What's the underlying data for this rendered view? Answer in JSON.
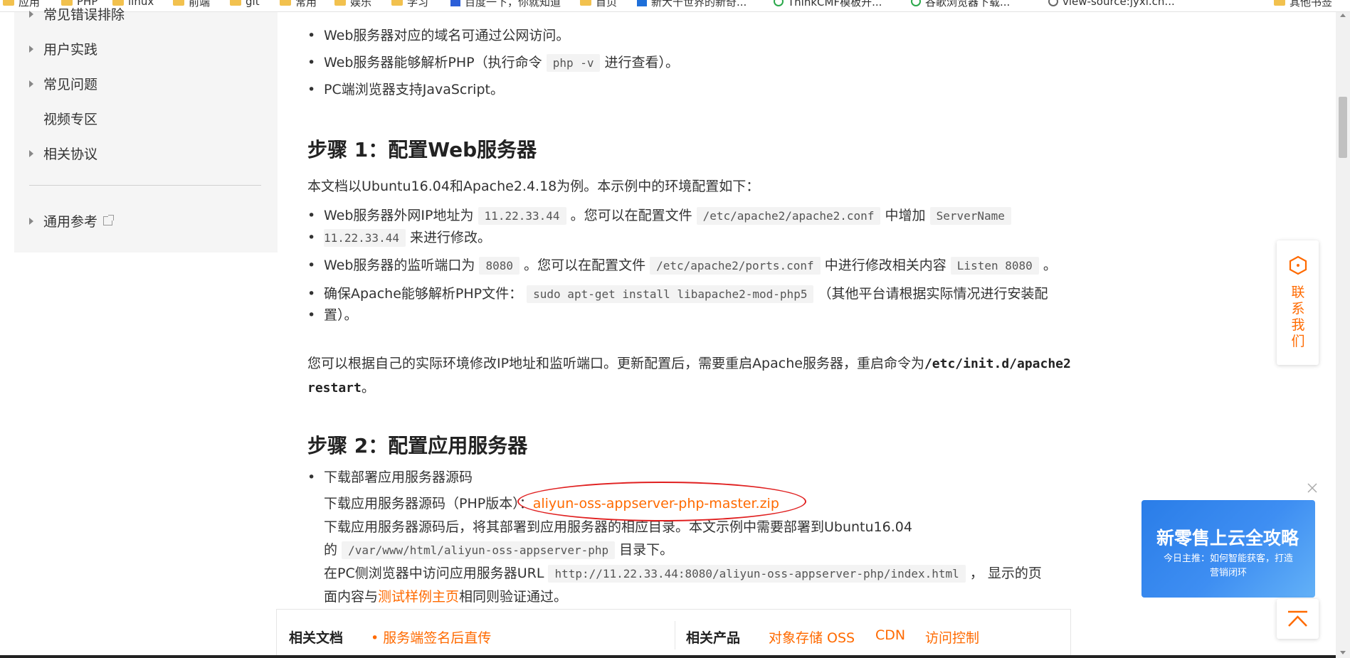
{
  "bookmarks": [
    {
      "label": "应用",
      "icon": "apps-icon"
    },
    {
      "label": "PHP",
      "icon": "folder-icon"
    },
    {
      "label": "linux",
      "icon": "folder-icon"
    },
    {
      "label": "前端",
      "icon": "folder-icon"
    },
    {
      "label": "git",
      "icon": "folder-icon"
    },
    {
      "label": "常用",
      "icon": "folder-icon"
    },
    {
      "label": "娱乐",
      "icon": "folder-icon"
    },
    {
      "label": "学习",
      "icon": "folder-icon"
    },
    {
      "label": "百度一下，你就知道",
      "icon": "paw-icon"
    },
    {
      "label": "首页",
      "icon": "folder-icon"
    },
    {
      "label": "新大千世界的新奇...",
      "icon": "news-icon"
    },
    {
      "label": "ThinkCMF模板开...",
      "icon": "leaf-icon"
    },
    {
      "label": "谷歌浏览器下载...",
      "icon": "leaf-icon"
    },
    {
      "label": "view-source:jyxl.cn...",
      "icon": "globe-icon"
    },
    {
      "label": "其他书签",
      "icon": "folder-icon"
    }
  ],
  "sidebar": {
    "items": [
      {
        "label": "常见错误排除",
        "expandable": true
      },
      {
        "label": "用户实践",
        "expandable": true
      },
      {
        "label": "常见问题",
        "expandable": true
      },
      {
        "label": "视频专区",
        "expandable": false
      },
      {
        "label": "相关协议",
        "expandable": true
      }
    ],
    "reference": {
      "label": "通用参考"
    }
  },
  "prereq": {
    "b1": "Web服务器对应的域名可通过公网访问。",
    "b2_pre": "Web服务器能够解析PHP（执行命令",
    "b2_code": "php -v",
    "b2_post": "进行查看）。",
    "b3": "PC端浏览器支持JavaScript。"
  },
  "step1": {
    "title": "步骤 1：配置Web服务器",
    "intro": "本文档以Ubuntu16.04和Apache2.4.18为例。本示例中的环境配置如下：",
    "b1_pre": "Web服务器外网IP地址为",
    "b1_code1": "11.22.33.44",
    "b1_mid": "。您可以在配置文件",
    "b1_code2": "/etc/apache2/apache2.conf",
    "b1_mid2": "中增加",
    "b1_code3": "ServerName",
    "b1_code4": "11.22.33.44",
    "b1_post": "来进行修改。",
    "b2_pre": "Web服务器的监听端口为",
    "b2_code1": "8080",
    "b2_mid": "。您可以在配置文件",
    "b2_code2": "/etc/apache2/ports.conf",
    "b2_mid2": "中进行修改相关内容",
    "b2_code3": "Listen 8080",
    "b2_post": "。",
    "b3_pre": "确保Apache能够解析PHP文件：",
    "b3_code": "sudo apt-get install libapache2-mod-php5",
    "b3_post": "（其他平台请根据实际情况进行安装配",
    "b3_line2": "置）。",
    "note_l1": "您可以根据自己的实际环境修改IP地址和监听端口。更新配置后，需要重启Apache服务器，重启命令为",
    "note_code1": "/etc/init.d/apache2",
    "note_code2": "restart",
    "note_end": "。"
  },
  "step2": {
    "title": "步骤 2：配置应用服务器",
    "b1": "下载部署应用服务器源码",
    "l2_pre": "下载应用服务器源码（PHP版本）：",
    "l2_link": "aliyun-oss-appserver-php-master.zip",
    "l3": "下载应用服务器源码后，将其部署到应用服务器的相应目录。本文示例中需要部署到Ubuntu16.04",
    "l4_pre": "的",
    "l4_code": "/var/www/html/aliyun-oss-appserver-php",
    "l4_post": "目录下。",
    "l5_pre": "在PC侧浏览器中访问应用服务器URL",
    "l5_code": "http://11.22.33.44:8080/aliyun-oss-appserver-php/index.html",
    "l5_post": "，  显示的页",
    "l6_pre": "面内容与",
    "l6_link": "测试样例主页",
    "l6_post": "相同则验证通过。"
  },
  "related": {
    "docs_label": "相关文档",
    "docs_link": "• 服务端签名后直传",
    "products_label": "相关产品",
    "products": [
      "对象存储 OSS",
      "CDN",
      "访问控制"
    ]
  },
  "contact": {
    "label": "联系我们",
    "chars": [
      "联",
      "系",
      "我",
      "们"
    ]
  },
  "ad": {
    "title": "新零售上云全攻略",
    "sub1": "今日主推：如何智能获客，打造",
    "sub2": "营销闭环"
  },
  "colors": {
    "accent": "#ff6a00",
    "annotation": "#e02020",
    "ad_blue": "#2a7de8"
  }
}
